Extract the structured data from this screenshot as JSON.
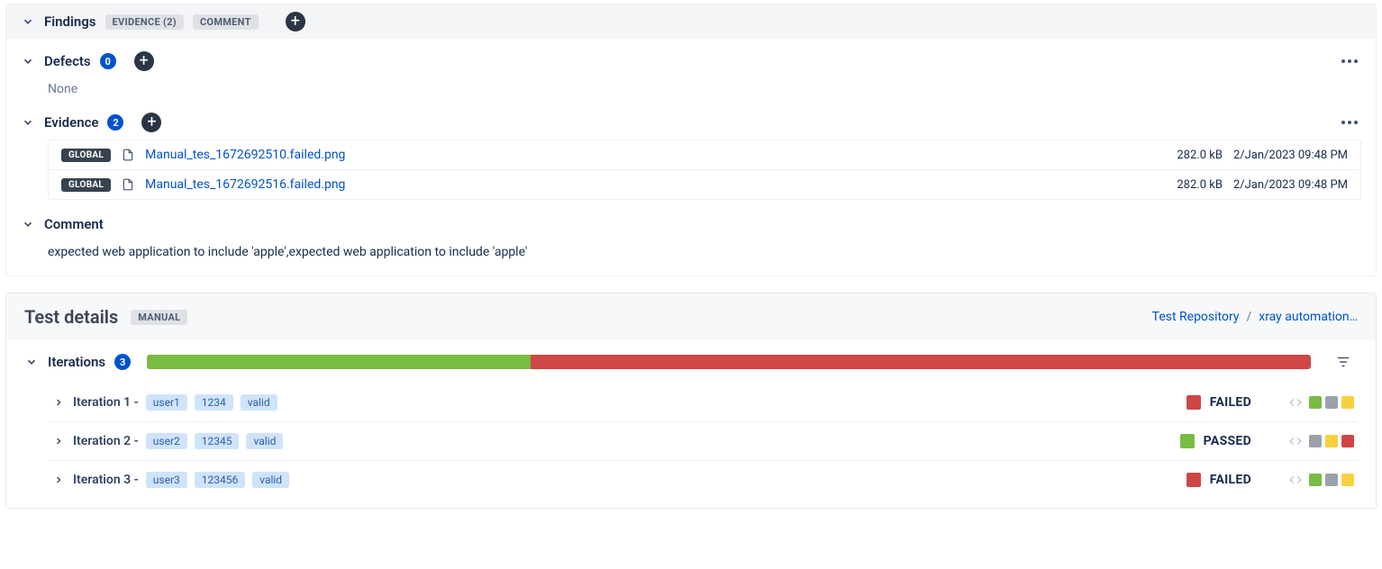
{
  "findings": {
    "title": "Findings",
    "tags": {
      "evidence": "EVIDENCE (2)",
      "comment": "COMMENT"
    }
  },
  "defects": {
    "title": "Defects",
    "count": "0",
    "none_text": "None"
  },
  "evidence": {
    "title": "Evidence",
    "count": "2",
    "items": [
      {
        "scope": "GLOBAL",
        "filename": "Manual_tes_1672692510.failed.png",
        "size": "282.0 kB",
        "date": "2/Jan/2023 09:48 PM"
      },
      {
        "scope": "GLOBAL",
        "filename": "Manual_tes_1672692516.failed.png",
        "size": "282.0 kB",
        "date": "2/Jan/2023 09:48 PM"
      }
    ]
  },
  "comment": {
    "title": "Comment",
    "text": "expected web application to include 'apple',expected web application to include 'apple'"
  },
  "test_details": {
    "title": "Test details",
    "type_badge": "MANUAL",
    "breadcrumb": {
      "repo": "Test Repository",
      "path": "xray automation…"
    }
  },
  "iterations": {
    "title": "Iterations",
    "count": "3",
    "progress": {
      "pass_pct": 33,
      "fail_pct": 67
    },
    "rows": [
      {
        "label": "Iteration 1 -",
        "tags": [
          "user1",
          "1234",
          "valid"
        ],
        "status": "FAILED",
        "status_color": "sb-red",
        "actions": [
          "sb-green",
          "sb-gray",
          "sb-yellow"
        ]
      },
      {
        "label": "Iteration 2 -",
        "tags": [
          "user2",
          "12345",
          "valid"
        ],
        "status": "PASSED",
        "status_color": "sb-green",
        "actions": [
          "sb-gray",
          "sb-yellow",
          "sb-red"
        ]
      },
      {
        "label": "Iteration 3 -",
        "tags": [
          "user3",
          "123456",
          "valid"
        ],
        "status": "FAILED",
        "status_color": "sb-red",
        "actions": [
          "sb-green",
          "sb-gray",
          "sb-yellow"
        ]
      }
    ]
  }
}
